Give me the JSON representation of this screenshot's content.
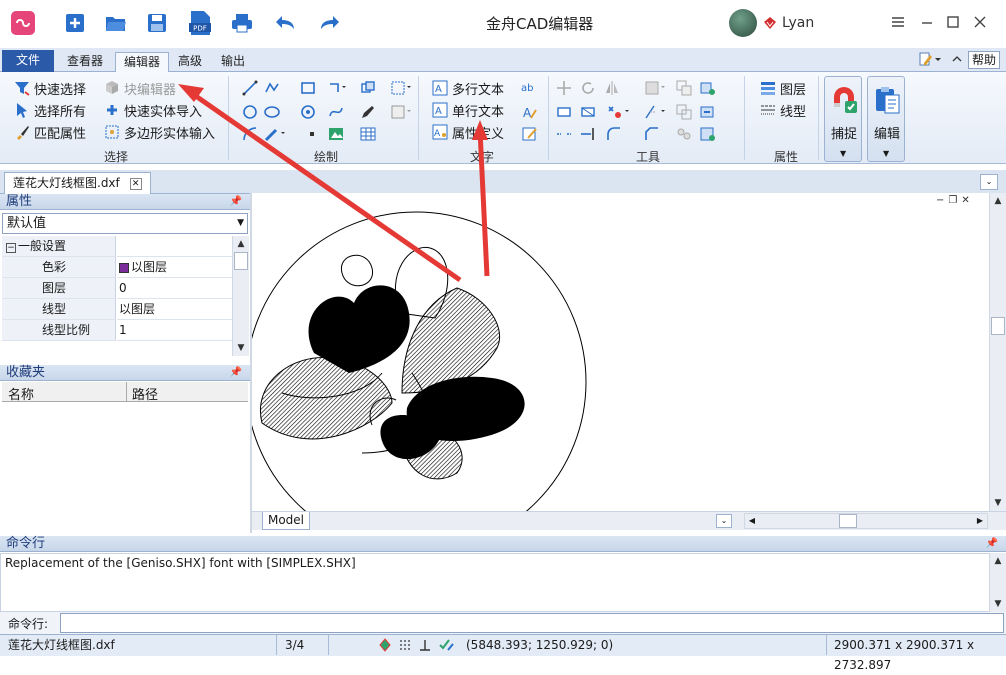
{
  "title_bar": {
    "app_title": "金舟CAD编辑器",
    "user_name": "Lyan",
    "quick_icons": [
      "logo-icon",
      "new-file-icon",
      "open-folder-icon",
      "save-icon",
      "pdf-icon",
      "print-icon",
      "undo-icon",
      "redo-icon"
    ],
    "pdf_label": "PDF",
    "window_controls": [
      "menu-icon",
      "minimize-icon",
      "maximize-icon",
      "close-icon"
    ]
  },
  "tabs": [
    {
      "label": "文件"
    },
    {
      "label": "查看器"
    },
    {
      "label": "编辑器"
    },
    {
      "label": "高级"
    },
    {
      "label": "输出"
    }
  ],
  "help_label": "帮助",
  "ribbon": {
    "select_group": {
      "label": "选择",
      "items": [
        "快速选择",
        "选择所有",
        "匹配属性",
        "块编辑器",
        "快速实体导入",
        "多边形实体输入"
      ]
    },
    "draw_group": {
      "label": "绘制"
    },
    "text_group": {
      "label": "文字",
      "items": [
        "多行文本",
        "单行文本",
        "属性定义"
      ]
    },
    "tools_group": {
      "label": "工具"
    },
    "props_group": {
      "label": "属性",
      "items": [
        "图层",
        "线型"
      ]
    },
    "big_buttons": [
      "捕捉",
      "编辑"
    ]
  },
  "document_tab": "莲花大灯线框图.dxf",
  "properties_panel": {
    "title": "属性",
    "selector_value": "默认值",
    "section": "一般设置",
    "rows": [
      {
        "key": "色彩",
        "value": "以图层"
      },
      {
        "key": "图层",
        "value": "0"
      },
      {
        "key": "线型",
        "value": "以图层"
      },
      {
        "key": "线型比例",
        "value": "1"
      }
    ]
  },
  "favorites_panel": {
    "title": "收藏夹",
    "columns": [
      "名称",
      "路径"
    ]
  },
  "canvas": {
    "model_tab": "Model"
  },
  "command": {
    "panel_title": "命令行",
    "output": "Replacement of the [Geniso.SHX] font with [SIMPLEX.SHX]",
    "input_label": "命令行:",
    "input_value": ""
  },
  "status": {
    "file": "莲花大灯线框图.dxf",
    "page": "3/4",
    "coords": "(5848.393; 1250.929; 0)",
    "dimensions": "2900.371 x 2900.371 x 2732.897"
  },
  "colors": {
    "accent": "#2a5aa8",
    "highlight_box": "#e53935",
    "annotation_arrow": "#e53935",
    "color_swatch": "#7b2d9a"
  }
}
